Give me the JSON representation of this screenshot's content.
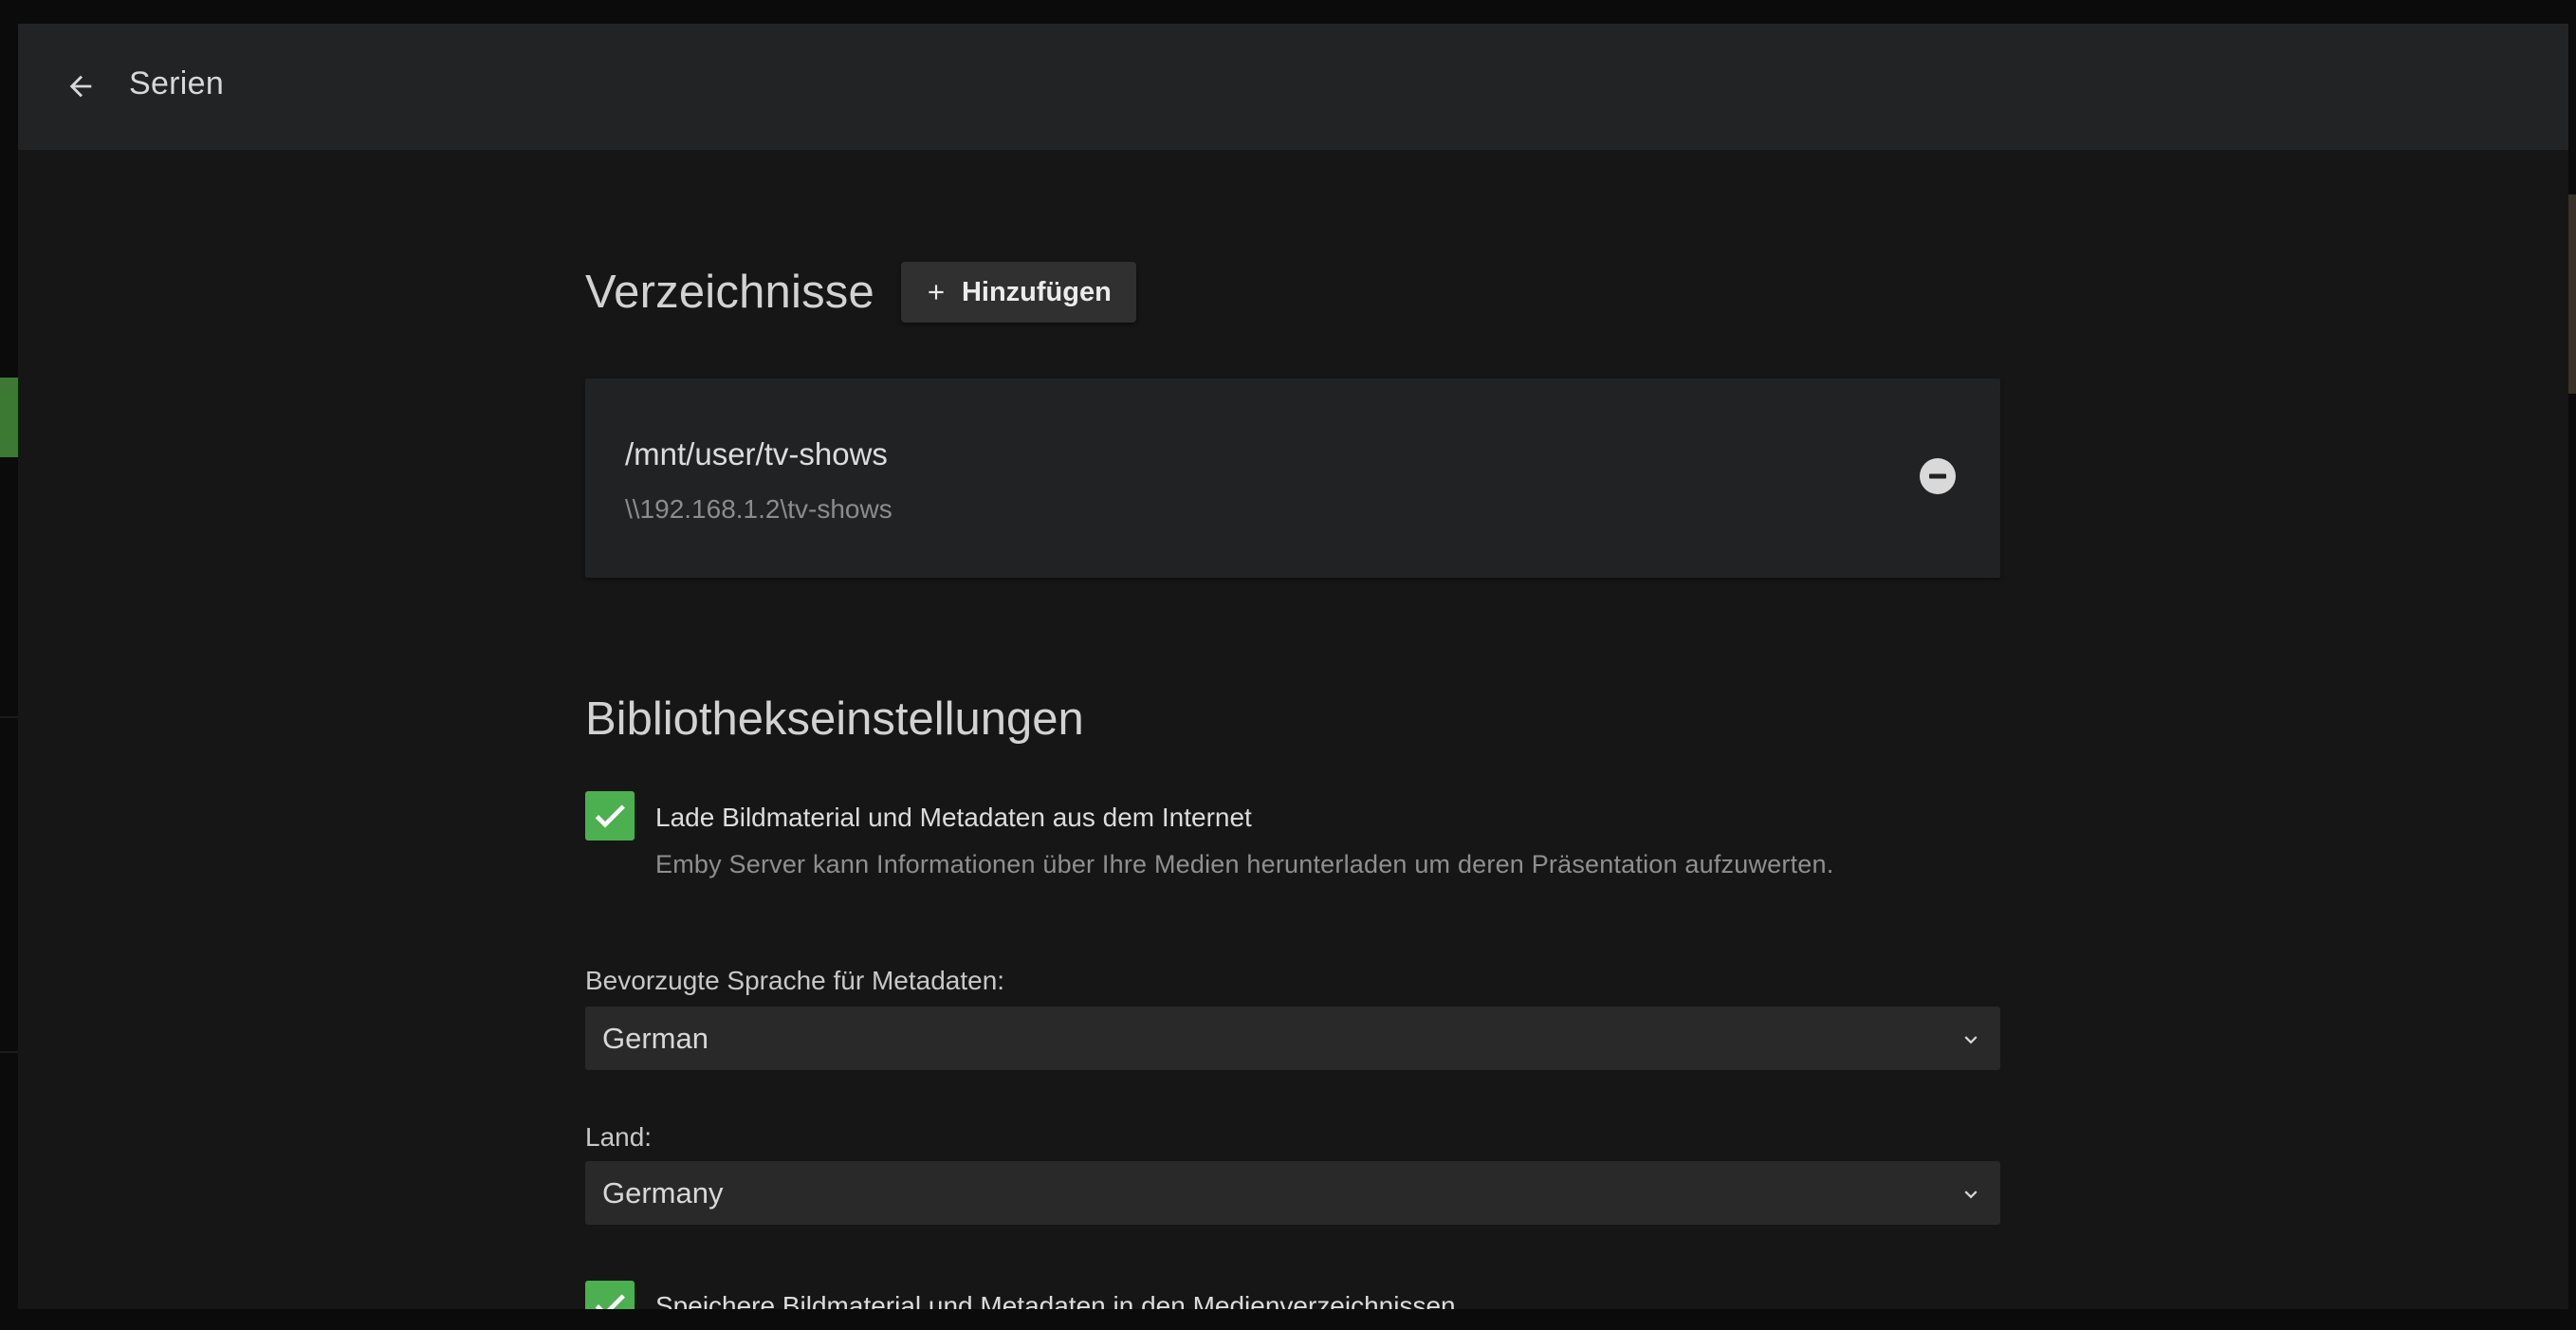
{
  "dialog": {
    "title": "Serien",
    "back_icon": "arrow-left-icon"
  },
  "folders": {
    "heading": "Verzeichnisse",
    "add_label": "Hinzufügen",
    "add_icon": "plus-icon",
    "items": [
      {
        "path": "/mnt/user/tv-shows",
        "network_path": "\\\\192.168.1.2\\tv-shows",
        "remove_icon": "minus-circle-icon"
      }
    ]
  },
  "library_settings": {
    "heading": "Bibliothekseinstellungen",
    "download_metadata": {
      "label": "Lade Bildmaterial und Metadaten aus dem Internet",
      "description": "Emby Server kann Informationen über Ihre Medien herunterladen um deren Präsentation aufzuwerten.",
      "checked": true
    },
    "metadata_language": {
      "label": "Bevorzugte Sprache für Metadaten:",
      "value": "German"
    },
    "country": {
      "label": "Land:",
      "value": "Germany"
    },
    "save_local": {
      "label": "Speichere Bildmaterial und Metadaten in den Medienverzeichnissen",
      "checked": true
    }
  },
  "colors": {
    "accent": "#4caf50",
    "header_bg": "#222325",
    "dialog_bg": "#161616",
    "card_bg": "#212224"
  }
}
